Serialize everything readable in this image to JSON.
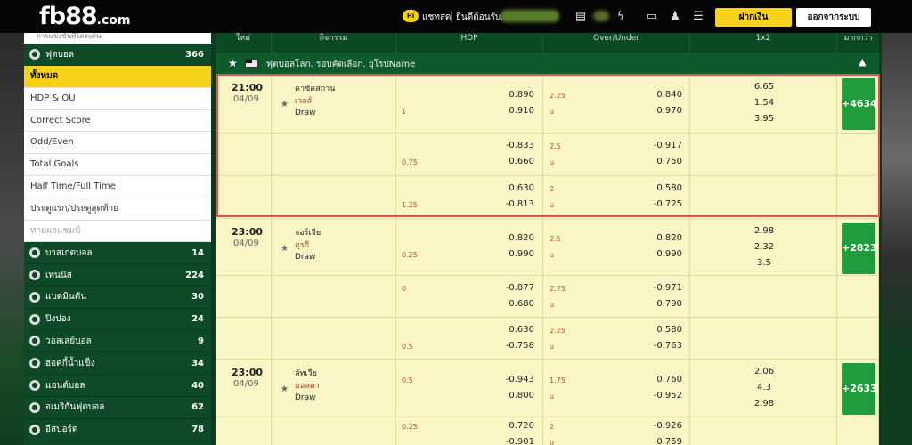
{
  "header": {
    "logo_main": "fb88",
    "logo_suffix": ".com",
    "hi_badge": "Hi",
    "chat": "แชทสด",
    "welcome": "ยินดีต้อนรับ,",
    "deposit": "ฝากเงิน",
    "logout": "ออกจากระบบ",
    "icons": [
      "card-icon",
      "coin-icon",
      "refresh-icon",
      "promo-ticket-icon",
      "user-icon",
      "list-icon"
    ]
  },
  "sidebar": {
    "top_text": "การแข่งขันที่โดดเด่น",
    "football": {
      "label": "ฟุตบอล",
      "count": "366"
    },
    "sub_items": [
      "ทั้งหมด",
      "HDP & OU",
      "Correct Score",
      "Odd/Even",
      "Total Goals",
      "Half Time/Full Time",
      "ประตูแรก/ประตูสุดท้าย",
      "ทายผลแชมป์"
    ],
    "sports": [
      {
        "label": "บาสเกตบอล",
        "count": "14"
      },
      {
        "label": "เทนนิส",
        "count": "224"
      },
      {
        "label": "แบดมินตัน",
        "count": "30"
      },
      {
        "label": "ปิงปอง",
        "count": "24"
      },
      {
        "label": "วอลเลย์บอล",
        "count": "9"
      },
      {
        "label": "ฮอคกี้น้ำแข็ง",
        "count": "34"
      },
      {
        "label": "แฮนด์บอล",
        "count": "40"
      },
      {
        "label": "อเมริกันฟุตบอล",
        "count": "62"
      },
      {
        "label": "อีสปอร์ต",
        "count": "78"
      }
    ]
  },
  "table": {
    "columns": [
      "ใหม่",
      "กิจกรรม",
      "HDP",
      "Over/Under",
      "1x2",
      "มากกว่า"
    ],
    "league": "ฟุตบอลโลก. รอบคัดเลือก. ยุโรปName",
    "matches": [
      {
        "time": "21:00",
        "date": "04/09",
        "home": "คาซัคสถาน",
        "away": "เวลส์",
        "draw": "Draw",
        "more": "+4634",
        "x12": [
          "6.65",
          "1.54",
          "3.95"
        ],
        "lines": [
          {
            "hdp_top": "",
            "hdp_bot": "1",
            "h1": "0.890",
            "h2": "0.910",
            "ou_top": "2.25",
            "ou_bot": "u",
            "o1": "0.840",
            "o2": "0.970"
          },
          {
            "hdp_top": "",
            "hdp_bot": "0.75",
            "h1": "-0.833",
            "h2": "0.660",
            "ou_top": "2.5",
            "ou_bot": "u",
            "o1": "-0.917",
            "o2": "0.750"
          },
          {
            "hdp_top": "",
            "hdp_bot": "1.25",
            "h1": "0.630",
            "h2": "-0.813",
            "ou_top": "2",
            "ou_bot": "u",
            "o1": "0.580",
            "o2": "-0.725"
          }
        ]
      },
      {
        "time": "23:00",
        "date": "04/09",
        "home": "จอร์เจีย",
        "away": "ตุรกี",
        "draw": "Draw",
        "more": "+2823",
        "x12": [
          "2.98",
          "2.32",
          "3.5"
        ],
        "lines": [
          {
            "hdp_top": "",
            "hdp_bot": "0.25",
            "h1": "0.820",
            "h2": "0.990",
            "ou_top": "2.5",
            "ou_bot": "u",
            "o1": "0.820",
            "o2": "0.990"
          },
          {
            "hdp_top": "0",
            "hdp_bot": "",
            "h1": "-0.877",
            "h2": "0.680",
            "ou_top": "2.75",
            "ou_bot": "u",
            "o1": "-0.971",
            "o2": "0.790"
          },
          {
            "hdp_top": "",
            "hdp_bot": "0.5",
            "h1": "0.630",
            "h2": "-0.758",
            "ou_top": "2.25",
            "ou_bot": "u",
            "o1": "0.580",
            "o2": "-0.763"
          }
        ]
      },
      {
        "time": "23:00",
        "date": "04/09",
        "home": "ลัทเวีย",
        "away": "มอลตา",
        "draw": "Draw",
        "more": "+2633",
        "x12": [
          "2.06",
          "4.3",
          "2.98"
        ],
        "lines": [
          {
            "hdp_top": "0.5",
            "hdp_bot": "",
            "h1": "-0.943",
            "h2": "0.800",
            "ou_top": "1.75",
            "ou_bot": "u",
            "o1": "0.760",
            "o2": "-0.952"
          },
          {
            "hdp_top": "0.25",
            "hdp_bot": "",
            "h1": "0.720",
            "h2": "-0.901",
            "ou_top": "2",
            "ou_bot": "u",
            "o1": "-0.926",
            "o2": "0.759"
          }
        ]
      }
    ]
  }
}
